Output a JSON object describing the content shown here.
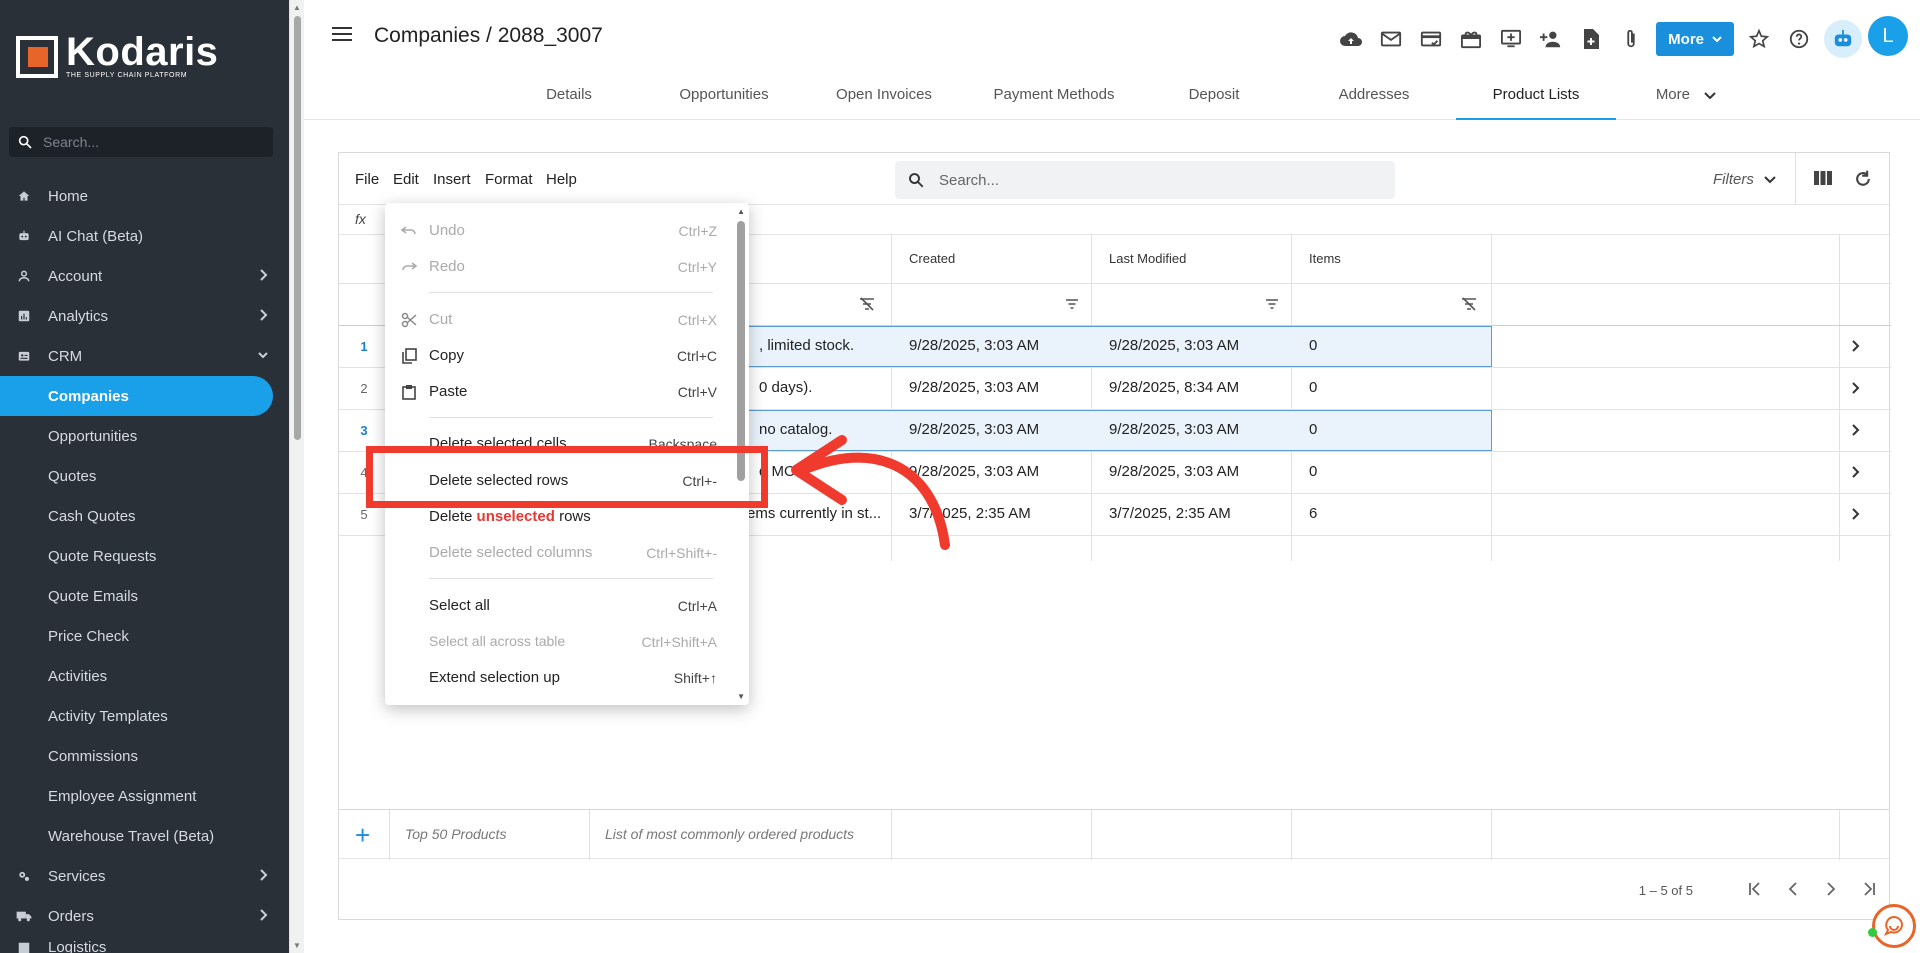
{
  "sidebar": {
    "brand": "Kodaris",
    "tagline": "THE SUPPLY CHAIN PLATFORM",
    "search_placeholder": "Search...",
    "items": [
      {
        "label": "Home"
      },
      {
        "label": "AI Chat (Beta)"
      },
      {
        "label": "Account"
      },
      {
        "label": "Analytics"
      },
      {
        "label": "CRM"
      },
      {
        "label": "Companies"
      },
      {
        "label": "Opportunities"
      },
      {
        "label": "Quotes"
      },
      {
        "label": "Cash Quotes"
      },
      {
        "label": "Quote Requests"
      },
      {
        "label": "Quote Emails"
      },
      {
        "label": "Price Check"
      },
      {
        "label": "Activities"
      },
      {
        "label": "Activity Templates"
      },
      {
        "label": "Commissions"
      },
      {
        "label": "Employee Assignment"
      },
      {
        "label": "Warehouse Travel (Beta)"
      },
      {
        "label": "Services"
      },
      {
        "label": "Orders"
      },
      {
        "label": "Logistics"
      }
    ]
  },
  "header": {
    "title": "Companies / 2088_3007",
    "more_label": "More",
    "avatar_initial": "L"
  },
  "tabs": [
    {
      "label": "Details"
    },
    {
      "label": "Opportunities"
    },
    {
      "label": "Open Invoices"
    },
    {
      "label": "Payment Methods"
    },
    {
      "label": "Deposit"
    },
    {
      "label": "Addresses"
    },
    {
      "label": "Product Lists"
    },
    {
      "label": "More"
    }
  ],
  "grid": {
    "menu": [
      "File",
      "Edit",
      "Insert",
      "Format",
      "Help"
    ],
    "search_placeholder": "Search...",
    "filters_label": "Filters",
    "fx": "fx",
    "columns": [
      "Created",
      "Last Modified",
      "Items"
    ],
    "rows": [
      {
        "num": "1",
        "desc": ", limited stock.",
        "created": "9/28/2025, 3:03 AM",
        "modified": "9/28/2025, 3:03 AM",
        "items": "0"
      },
      {
        "num": "2",
        "desc": "0 days).",
        "created": "9/28/2025, 3:03 AM",
        "modified": "9/28/2025, 8:34 AM",
        "items": "0"
      },
      {
        "num": "3",
        "desc": "no catalog.",
        "created": "9/28/2025, 3:03 AM",
        "modified": "9/28/2025, 3:03 AM",
        "items": "0"
      },
      {
        "num": "4",
        "desc": "d MOQ.",
        "created": "9/28/2025, 3:03 AM",
        "modified": "9/28/2025, 3:03 AM",
        "items": "0"
      },
      {
        "num": "5",
        "desc": "ems currently in st...",
        "created": "3/7/2025, 2:35 AM",
        "modified": "3/7/2025, 2:35 AM",
        "items": "6"
      }
    ],
    "new_row": {
      "name": "Top 50 Products",
      "description": "List of most commonly ordered products"
    },
    "pager": "1 – 5 of 5"
  },
  "context_menu": {
    "items": [
      {
        "label": "Undo",
        "shortcut": "Ctrl+Z"
      },
      {
        "label": "Redo",
        "shortcut": "Ctrl+Y"
      },
      {
        "label": "Cut",
        "shortcut": "Ctrl+X"
      },
      {
        "label": "Copy",
        "shortcut": "Ctrl+C"
      },
      {
        "label": "Paste",
        "shortcut": "Ctrl+V"
      },
      {
        "label": "Delete selected cells",
        "shortcut": "Backspace"
      },
      {
        "label": "Delete selected rows",
        "shortcut": "Ctrl+-"
      },
      {
        "label_prefix": "Delete ",
        "label_red": "unselected",
        "label_suffix": " rows"
      },
      {
        "label": "Delete selected columns",
        "shortcut": "Ctrl+Shift+-"
      },
      {
        "label": "Select all",
        "shortcut": "Ctrl+A"
      },
      {
        "label": "Select all across table",
        "shortcut": "Ctrl+Shift+A"
      },
      {
        "label": "Extend selection up",
        "shortcut": "Shift+↑"
      }
    ]
  },
  "colors": {
    "sidebar_bg": "#2a3038",
    "accent": "#1aa0e8",
    "highlight": "#f03a2e",
    "brand_orange": "#e8652a"
  }
}
